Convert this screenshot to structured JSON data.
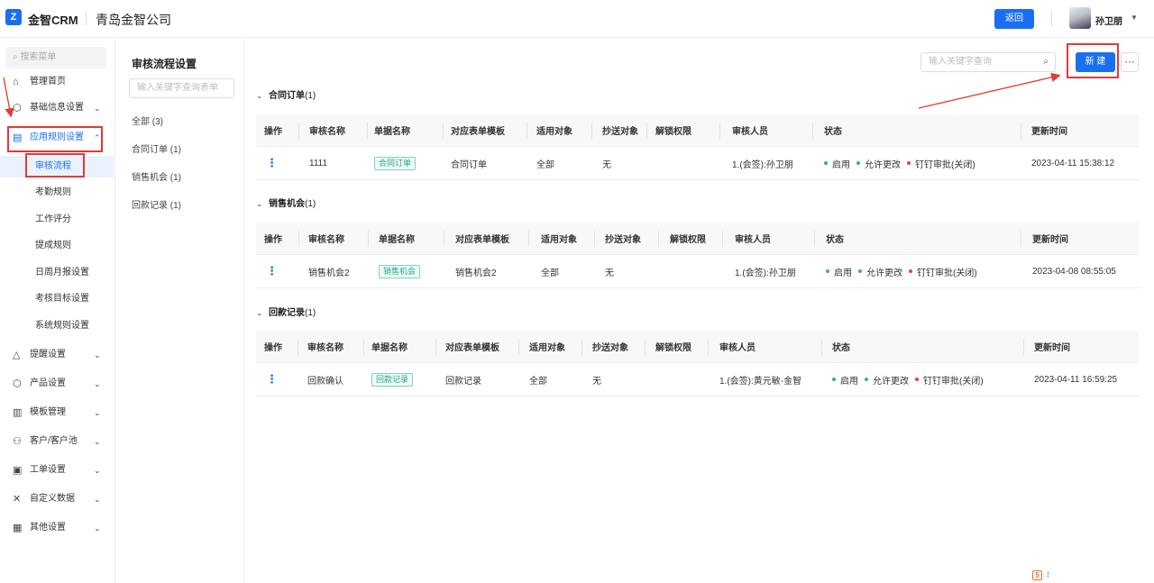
{
  "header": {
    "logo_mark": "Z",
    "app_name": "金智CRM",
    "company": "青岛金智公司",
    "back_label": "返回",
    "username": "孙卫朋"
  },
  "sidebar": {
    "search_placeholder": "搜索菜单",
    "items": [
      {
        "icon": "home-icon",
        "label": "管理首页",
        "glyph": "⌂"
      },
      {
        "icon": "cube-icon",
        "label": "基础信息设置",
        "glyph": "⬡"
      },
      {
        "icon": "document-icon",
        "label": "应用规则设置",
        "glyph": "▤"
      },
      {
        "icon": "bell-icon",
        "label": "提醒设置",
        "glyph": "△"
      },
      {
        "icon": "package-icon",
        "label": "产品设置",
        "glyph": "⬡"
      },
      {
        "icon": "template-icon",
        "label": "模板管理",
        "glyph": "▥"
      },
      {
        "icon": "users-icon",
        "label": "客户/客户池",
        "glyph": "⚇"
      },
      {
        "icon": "ticket-icon",
        "label": "工单设置",
        "glyph": "▣"
      },
      {
        "icon": "tools-icon",
        "label": "自定义数据",
        "glyph": "✕"
      },
      {
        "icon": "grid-icon",
        "label": "其他设置",
        "glyph": "▦"
      }
    ],
    "sub_items": [
      "审核流程",
      "考勤规则",
      "工作评分",
      "提成规则",
      "日周月报设置",
      "考核目标设置",
      "系统规则设置"
    ]
  },
  "middle": {
    "page_title": "审核流程设置",
    "search_placeholder": "输入关键字查询表单",
    "filters": [
      "全部  (3)",
      "合同订单  (1)",
      "销售机会  (1)",
      "回款记录  (1)"
    ]
  },
  "main": {
    "search_placeholder": "输入关键字查询",
    "new_label": "新 建",
    "more_label": "···",
    "headers": [
      "操作",
      "审核名称",
      "单据名称",
      "对应表单模板",
      "适用对象",
      "抄送对象",
      "解锁权限",
      "审核人员",
      "状态",
      "更新时间"
    ],
    "status_labels": [
      "启用",
      "允许更改",
      "钉钉审批(关闭)"
    ],
    "sections": [
      {
        "title": "合同订单",
        "count": "(1)",
        "row": {
          "action": "⋮",
          "name": "1111",
          "doc": "合同订单",
          "template": "合同订单",
          "scope": "全部",
          "cc": "无",
          "unlock": "",
          "approver": "1.(会签):孙卫朋",
          "updated": "2023-04-11 15:38:12"
        }
      },
      {
        "title": "销售机会",
        "count": "(1)",
        "row": {
          "action": "⋮",
          "name": "销售机会2",
          "doc": "销售机会",
          "template": "销售机会2",
          "scope": "全部",
          "cc": "无",
          "unlock": "",
          "approver": "1.(会签):孙卫朋",
          "updated": "2023-04-08 08:55:05"
        }
      },
      {
        "title": "回款记录",
        "count": "(1)",
        "row": {
          "action": "⋮",
          "name": "回款确认",
          "doc": "回款记录",
          "template": "回款记录",
          "scope": "全部",
          "cc": "无",
          "unlock": "",
          "approver": "1.(会签):黄元敏-金智",
          "updated": "2023-04-11 16:59:25"
        }
      }
    ]
  },
  "colors": {
    "primary": "#1a6ff0",
    "annotation": "#e23a35",
    "tag_green": "#2aa486",
    "status_green": "#3cb94a",
    "status_red": "#e8413c"
  }
}
